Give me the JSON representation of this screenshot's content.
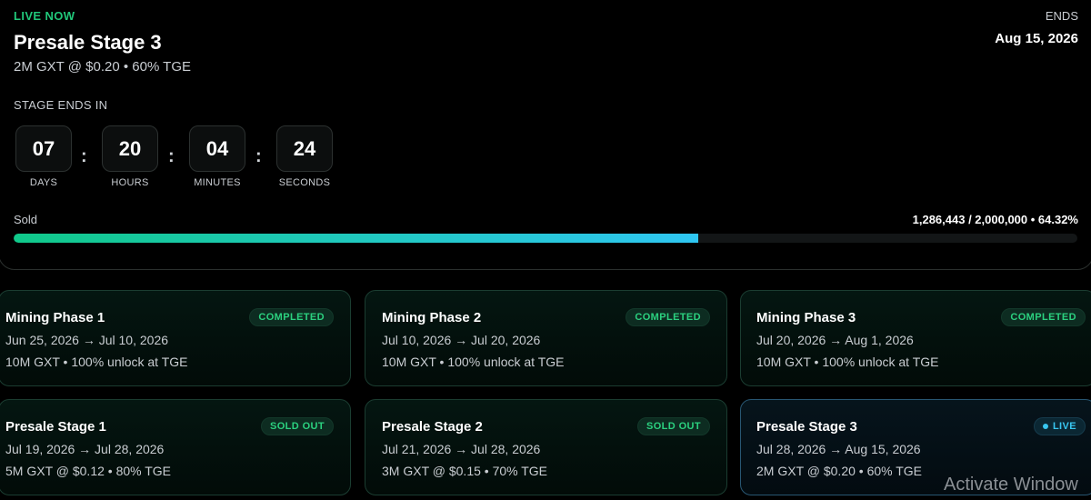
{
  "hero": {
    "status": "LIVE NOW",
    "title": "Presale Stage 3",
    "subtitle": "2M GXT @ $0.20 • 60% TGE",
    "ends_label": "ENDS",
    "ends_date": "Aug 15, 2026",
    "countdown_label": "STAGE ENDS IN",
    "countdown": [
      {
        "value": "07",
        "unit": "DAYS"
      },
      {
        "value": "20",
        "unit": "HOURS"
      },
      {
        "value": "04",
        "unit": "MINUTES"
      },
      {
        "value": "24",
        "unit": "SECONDS"
      }
    ],
    "separator": ":",
    "sold_label": "Sold",
    "sold_stats": "1,286,443 / 2,000,000 • 64.32%",
    "sold_fraction": 0.6432,
    "progress_colors": [
      "#10c98a",
      "#2fc6f2"
    ]
  },
  "stages": [
    {
      "title": "Mining Phase 1",
      "badge": "COMPLETED",
      "dates": "Jun 25, 2026 → Jul 10, 2026",
      "detail": "10M GXT • 100% unlock at TGE",
      "status": "completed"
    },
    {
      "title": "Mining Phase 2",
      "badge": "COMPLETED",
      "dates": "Jul 10, 2026 → Jul 20, 2026",
      "detail": "10M GXT • 100% unlock at TGE",
      "status": "completed"
    },
    {
      "title": "Mining Phase 3",
      "badge": "COMPLETED",
      "dates": "Jul 20, 2026 → Aug 1, 2026",
      "detail": "10M GXT • 100% unlock at TGE",
      "status": "completed"
    },
    {
      "title": "Presale Stage 1",
      "badge": "SOLD OUT",
      "dates": "Jul 19, 2026 → Jul 28, 2026",
      "detail": "5M GXT @ $0.12 • 80% TGE",
      "status": "sold-out"
    },
    {
      "title": "Presale Stage 2",
      "badge": "SOLD OUT",
      "dates": "Jul 21, 2026 → Jul 28, 2026",
      "detail": "3M GXT @ $0.15 • 70% TGE",
      "status": "sold-out"
    },
    {
      "title": "Presale Stage 3",
      "badge": "LIVE",
      "dates": "Jul 28, 2026 → Aug 15, 2026",
      "detail": "2M GXT @ $0.20 • 60% TGE",
      "status": "live"
    }
  ],
  "colors": {
    "live_green": "#21c77a",
    "live_blue": "#38c6f0",
    "background": "#000000"
  },
  "watermark": "Activate Window"
}
